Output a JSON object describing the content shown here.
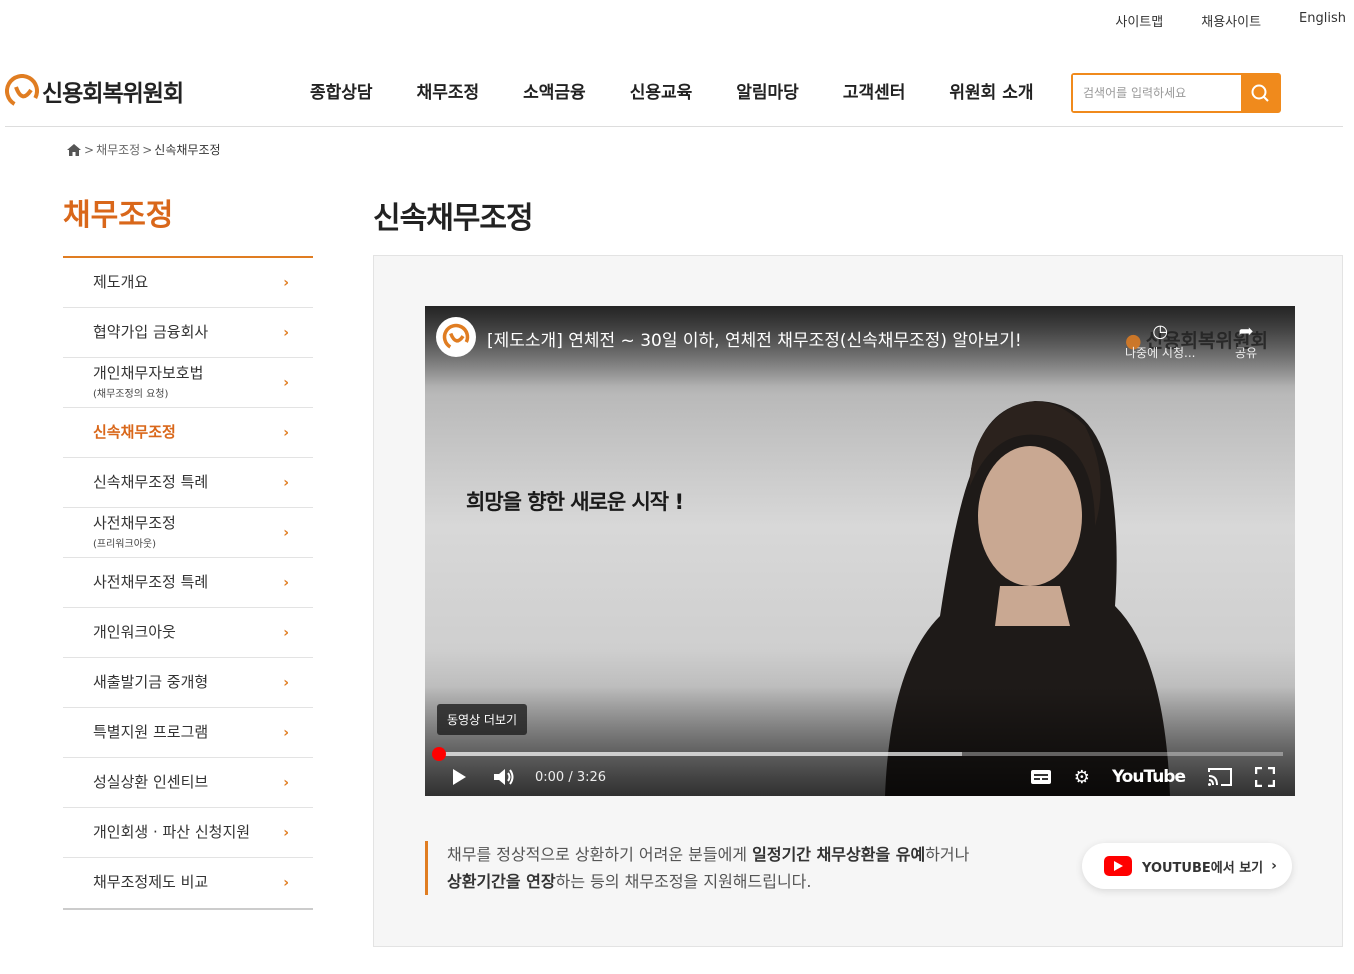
{
  "util_links": [
    "사이트맵",
    "채용사이트",
    "English"
  ],
  "logo": {
    "text": "신용회복위원회"
  },
  "gnb": [
    "종합상담",
    "채무조정",
    "소액금융",
    "신용교육",
    "알림마당",
    "고객센터",
    "위원회 소개"
  ],
  "search": {
    "placeholder": "검색어를 입력하세요"
  },
  "breadcrumb": {
    "level1": "채무조정",
    "level2": "신속채무조정"
  },
  "sidebar": {
    "title": "채무조정",
    "items": [
      {
        "label": "제도개요",
        "sub": ""
      },
      {
        "label": "협약가입 금융회사",
        "sub": ""
      },
      {
        "label": "개인채무자보호법",
        "sub": "(채무조정의 요청)"
      },
      {
        "label": "신속채무조정",
        "sub": "",
        "active": true
      },
      {
        "label": "신속채무조정 특례",
        "sub": ""
      },
      {
        "label": "사전채무조정",
        "sub": "(프리워크아웃)"
      },
      {
        "label": "사전채무조정 특례",
        "sub": ""
      },
      {
        "label": "개인워크아웃",
        "sub": ""
      },
      {
        "label": "새출발기금 중개형",
        "sub": ""
      },
      {
        "label": "특별지원 프로그램",
        "sub": ""
      },
      {
        "label": "성실상환 인센티브",
        "sub": ""
      },
      {
        "label": "개인회생 · 파산 신청지원",
        "sub": ""
      },
      {
        "label": "채무조정제도 비교",
        "sub": ""
      }
    ]
  },
  "main": {
    "title": "신속채무조정",
    "video": {
      "title": "[제도소개] 연체전 ~ 30일 이하, 연체전 채무조정(신속채무조정) 알아보기!",
      "watch_later": "나중에 시청...",
      "share": "공유",
      "brand": "신용회복위원회",
      "caption": "희망을 향한 새로운 시작 !",
      "more_videos": "동영상 더보기",
      "time": "0:00 / 3:26",
      "progress": 0.0,
      "buffered": 0.62,
      "youtube": "YouTube"
    },
    "desc": {
      "p1a": "채무를 정상적으로 상환하기 어려운 분들에게 ",
      "p1b": "일정기간 채무상환을 유예",
      "p1c": "하거나",
      "p2a": "상환기간을 연장",
      "p2b": "하는 등의 채무조정을 지원해드립니다."
    },
    "youtube_button": "YOUTUBE에서 보기"
  },
  "colors": {
    "accent": "#e07d22",
    "accent_dark": "#d9671a"
  }
}
